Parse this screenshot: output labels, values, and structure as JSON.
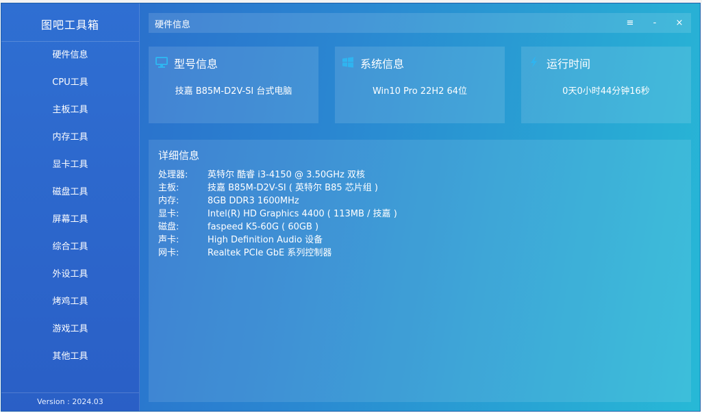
{
  "app": {
    "title": "图吧工具箱",
    "version": "Version : 2024.03"
  },
  "sidebar": {
    "items": [
      {
        "label": "硬件信息"
      },
      {
        "label": "CPU工具"
      },
      {
        "label": "主板工具"
      },
      {
        "label": "内存工具"
      },
      {
        "label": "显卡工具"
      },
      {
        "label": "磁盘工具"
      },
      {
        "label": "屏幕工具"
      },
      {
        "label": "综合工具"
      },
      {
        "label": "外设工具"
      },
      {
        "label": "烤鸡工具"
      },
      {
        "label": "游戏工具"
      },
      {
        "label": "其他工具"
      }
    ]
  },
  "titlebar": {
    "title": "硬件信息",
    "menu": "≡",
    "minimize": "-",
    "close": "×"
  },
  "cards": {
    "model": {
      "title": "型号信息",
      "value": "技嘉  B85M-D2V-SI 台式电脑",
      "icon": "monitor-icon"
    },
    "system": {
      "title": "系统信息",
      "value": "Win10 Pro 22H2 64位",
      "icon": "windows-icon"
    },
    "uptime": {
      "title": "运行时间",
      "value": "0天0小时44分钟16秒",
      "icon": "lightning-icon"
    }
  },
  "details": {
    "title": "详细信息",
    "rows": [
      {
        "key": "处理器:",
        "value": "英特尔 酷睿 i3-4150 @ 3.50GHz 双核"
      },
      {
        "key": "主板:",
        "value": "技嘉 B85M-D2V-SI ( 英特尔 B85 芯片组 )"
      },
      {
        "key": "内存:",
        "value": "8GB DDR3 1600MHz"
      },
      {
        "key": "显卡:",
        "value": "Intel(R) HD Graphics 4400 ( 113MB / 技嘉 )"
      },
      {
        "key": "磁盘:",
        "value": "faspeed K5-60G ( 60GB )"
      },
      {
        "key": "声卡:",
        "value": "High Definition Audio 设备"
      },
      {
        "key": "网卡:",
        "value": "Realtek PCIe GbE 系列控制器"
      }
    ]
  },
  "colors": {
    "accent": "#2a86d1",
    "sidebar": "#2f6fd2",
    "icon": "#2fb4f0"
  }
}
